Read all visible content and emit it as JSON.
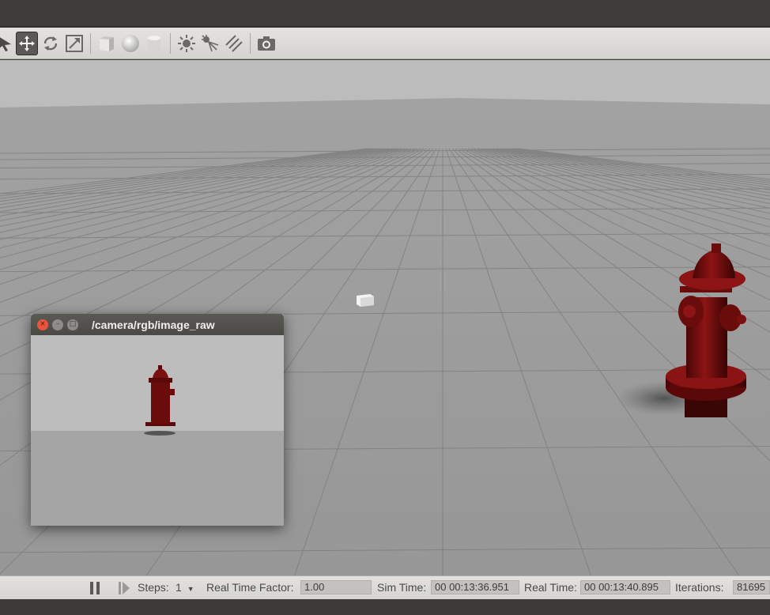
{
  "toolbar": {
    "tools": [
      {
        "name": "select-mode",
        "icon": "arrow-icon"
      },
      {
        "name": "translate-mode",
        "icon": "move-icon",
        "active": true
      },
      {
        "name": "rotate-mode",
        "icon": "rotate-icon"
      },
      {
        "name": "scale-mode",
        "icon": "scale-icon"
      },
      {
        "name": "box-shape",
        "icon": "box-icon"
      },
      {
        "name": "sphere-shape",
        "icon": "sphere-icon"
      },
      {
        "name": "cylinder-shape",
        "icon": "cylinder-icon"
      },
      {
        "name": "point-light",
        "icon": "sun-icon"
      },
      {
        "name": "spot-light",
        "icon": "spotlight-icon"
      },
      {
        "name": "directional-light",
        "icon": "directional-light-icon"
      },
      {
        "name": "screenshot",
        "icon": "camera-icon"
      }
    ]
  },
  "image_window": {
    "title": "/camera/rgb/image_raw",
    "close_glyph": "×",
    "min_glyph": "–",
    "max_glyph": "□"
  },
  "statusbar": {
    "steps_label": "Steps:",
    "steps_value": "1",
    "rtf_label": "Real Time Factor:",
    "rtf_value": "1.00",
    "sim_time_label": "Sim Time:",
    "sim_time_value": "00 00:13:36.951",
    "real_time_label": "Real Time:",
    "real_time_value": "00 00:13:40.895",
    "iterations_label": "Iterations:",
    "iterations_value": "81695"
  },
  "colors": {
    "hydrant": "#7a0f0f",
    "ground": "#9c9c9c",
    "sky": "#b8b8b8"
  }
}
